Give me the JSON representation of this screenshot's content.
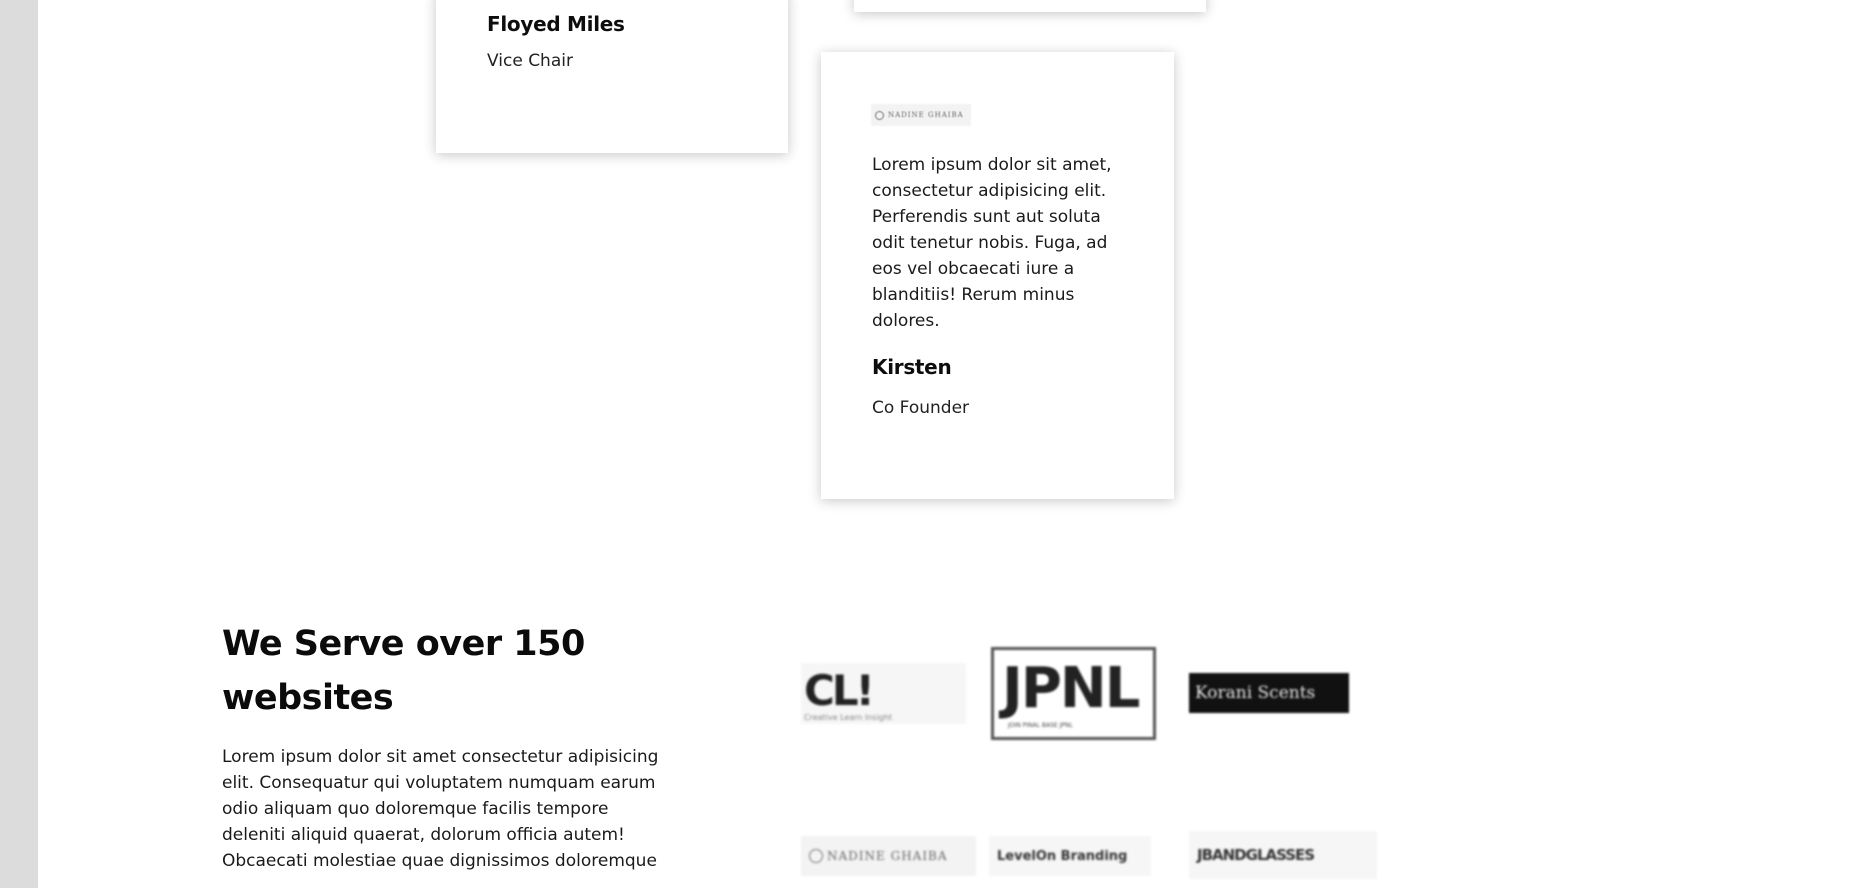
{
  "testimonials": [
    {
      "name": "Floyed Miles",
      "role": "Vice Chair"
    },
    {
      "logo": {
        "icon": "nadine-logo-icon",
        "text": "NADINE GHAIBA"
      },
      "quote": "Lorem ipsum dolor sit amet, consectetur adipisicing elit. Perferendis sunt aut soluta odit tenetur nobis. Fuga, ad eos vel obcaecati iure a blanditiis! Rerum minus dolores.",
      "name": "Kirsten",
      "role": "Co Founder"
    }
  ],
  "clients": {
    "title": "We Serve over 150 websites",
    "body": "Lorem ipsum dolor sit amet consectetur adipisicing elit. Consequatur qui voluptatem numquam earum odio aliquam quo doloremque facilis tempore deleniti aliquid quaerat, dolorum officia autem! Obcaecati molestiae quae dignissimos doloremque",
    "logos": [
      {
        "name": "cli-logo",
        "text": "CL!",
        "subtext": "Creative Learn Insight"
      },
      {
        "name": "jpnl-logo",
        "text": "JPNL",
        "subtext": "JOIN PINAL BASE JPNL"
      },
      {
        "name": "korani-scents-logo",
        "text": "Korani Scents"
      },
      {
        "name": "nadine-ghaiba-logo",
        "icon": "nadine-logo-icon",
        "text": "NADINE GHAIBA"
      },
      {
        "name": "creative-branding-logo",
        "text": "LevelOn Branding"
      },
      {
        "name": "jbandglasses-logo",
        "text": "JBANDGLASSES"
      }
    ]
  }
}
